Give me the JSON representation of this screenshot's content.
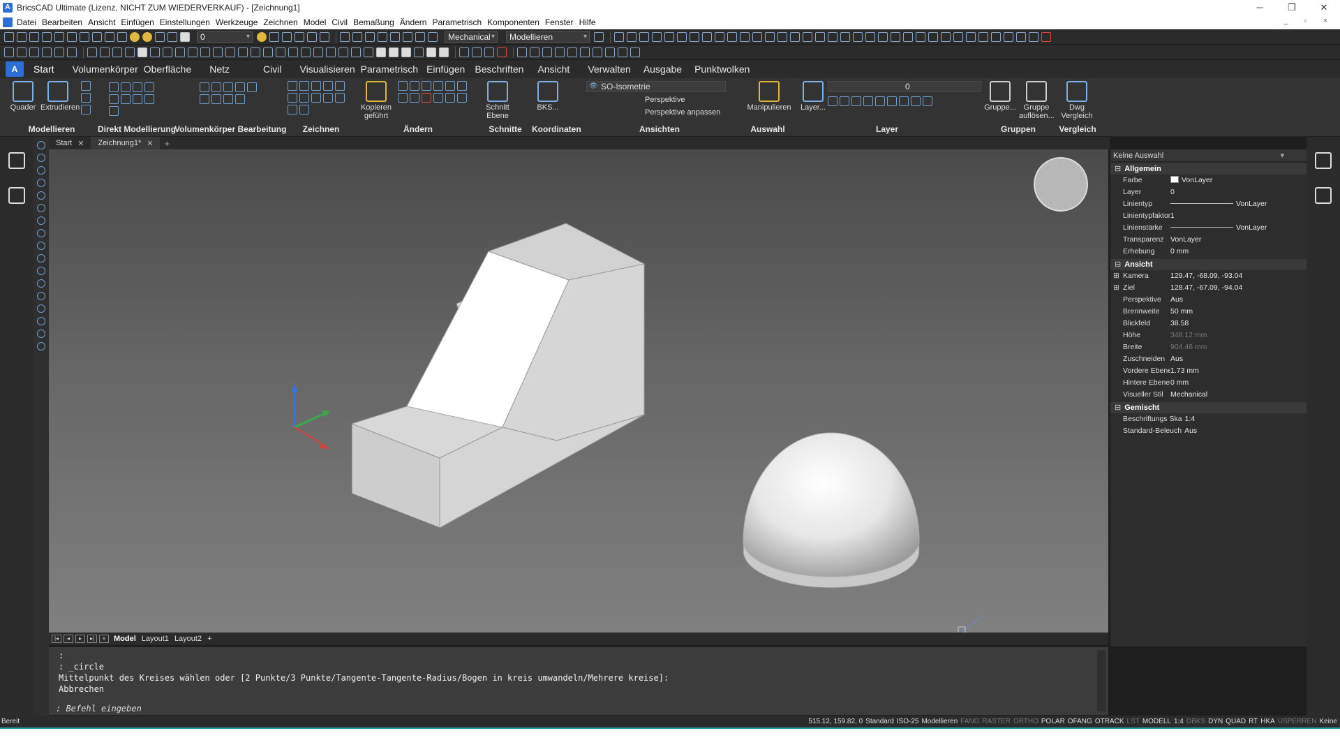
{
  "window": {
    "title": "BricsCAD Ultimate (Lizenz, NICHT ZUM WIEDERVERKAUF) - [Zeichnung1]",
    "minimize": "─",
    "maximize": "❐",
    "close": "✕"
  },
  "menu": [
    "Datei",
    "Bearbeiten",
    "Ansicht",
    "Einfügen",
    "Einstellungen",
    "Werkzeuge",
    "Zeichnen",
    "Model",
    "Civil",
    "Bemaßung",
    "Ändern",
    "Parametrisch",
    "Komponenten",
    "Fenster",
    "Hilfe"
  ],
  "toolbar1": {
    "layer_value": "0",
    "workspace_value": "Mechanical",
    "mode_value": "Modellieren"
  },
  "ribbon_tabs": [
    "Start",
    "Volumenkörper",
    "Oberfläche",
    "Netz",
    "Civil",
    "Visualisieren",
    "Parametrisch",
    "Einfügen",
    "Beschriften",
    "Ansicht",
    "Verwalten",
    "Ausgabe",
    "Punktwolken"
  ],
  "ribbon": {
    "quader": "Quader",
    "extrudieren": "Extrudieren",
    "kopieren": "Kopieren geführt",
    "schnitt": "Schnitt Ebene",
    "bks": "BKS...",
    "view_value": "SO-Isometrie",
    "perspektive": "Perspektive",
    "perspektive_anpassen": "Perspektive anpassen",
    "manipulieren": "Manipulieren",
    "layer_btn": "Layer...",
    "layer_value": "0",
    "gruppe": "Gruppe...",
    "gruppe_aufloesen": "Gruppe auflösen...",
    "dwg_vergleich": "Dwg Vergleich",
    "panels": [
      "Modellieren",
      "Direkt Modellierung",
      "Volumenkörper Bearbeitung",
      "Zeichnen",
      "Ändern",
      "Schnitte",
      "Koordinaten",
      "Ansichten",
      "Auswahl",
      "Layer",
      "Gruppen",
      "Vergleich"
    ]
  },
  "doc_tabs": {
    "start": "Start",
    "drawing": "Zeichnung1*",
    "plus": "+"
  },
  "layout_tabs": [
    "Model",
    "Layout1",
    "Layout2"
  ],
  "layout_plus": "+",
  "command": {
    "lines": [
      ":",
      ": _circle",
      "Mittelpunkt des Kreises wählen oder [2 Punkte/3 Punkte/Tangente-Tangente-Radius/Bogen in kreis umwandeln/Mehrere kreise]:",
      "Abbrechen"
    ],
    "prompt": ": Befehl eingeben"
  },
  "properties": {
    "selection": "Keine Auswahl",
    "categories": {
      "allgemein": "Allgemein",
      "ansicht": "Ansicht",
      "gemischt": "Gemischt"
    },
    "allgemein": [
      {
        "k": "Farbe",
        "v": "VonLayer"
      },
      {
        "k": "Layer",
        "v": "0"
      },
      {
        "k": "Linientyp",
        "v": "VonLayer"
      },
      {
        "k": "Linientypfaktor",
        "v": "1"
      },
      {
        "k": "Linienstärke",
        "v": "VonLayer"
      },
      {
        "k": "Transparenz",
        "v": "VonLayer"
      },
      {
        "k": "Erhebung",
        "v": "0 mm"
      }
    ],
    "ansicht": [
      {
        "k": "Kamera",
        "v": "129.47, -68.09, -93.04"
      },
      {
        "k": "Ziel",
        "v": "128.47, -67.09, -94.04"
      },
      {
        "k": "Perspektive",
        "v": "Aus"
      },
      {
        "k": "Brennweite",
        "v": "50 mm"
      },
      {
        "k": "Blickfeld",
        "v": "38.58"
      },
      {
        "k": "Höhe",
        "v": "348.12 mm"
      },
      {
        "k": "Breite",
        "v": "904.46 mm"
      },
      {
        "k": "Zuschneiden",
        "v": "Aus"
      },
      {
        "k": "Vordere Ebene",
        "v": "1.73 mm"
      },
      {
        "k": "Hintere Ebene",
        "v": "0 mm"
      },
      {
        "k": "Visueller Stil",
        "v": "Mechanical"
      }
    ],
    "gemischt": [
      {
        "k": "Beschriftungs Ska",
        "v": "1:4"
      },
      {
        "k": "Standard-Beleuch",
        "v": "Aus"
      }
    ]
  },
  "status": {
    "left": "Bereit",
    "coords": "515.12, 159.82, 0",
    "items": [
      "Standard",
      "ISO-25",
      "Modellieren",
      "FANG",
      "RASTER",
      "ORTHO",
      "POLAR",
      "OFANG",
      "OTRACK",
      "LST",
      "MODELL",
      "1:4",
      "DBKS",
      "DYN",
      "QUAD",
      "RT",
      "HKA",
      "USPERREN",
      "Keine"
    ],
    "off_flags": [
      false,
      false,
      false,
      true,
      true,
      true,
      false,
      false,
      false,
      true,
      false,
      false,
      true,
      false,
      false,
      false,
      false,
      true,
      false
    ]
  },
  "colors": {
    "accent": "#2d6fd6",
    "panel_bg": "#2d2d2d",
    "viewport_top": "#4a4a4a",
    "viewport_bottom": "#808080"
  }
}
